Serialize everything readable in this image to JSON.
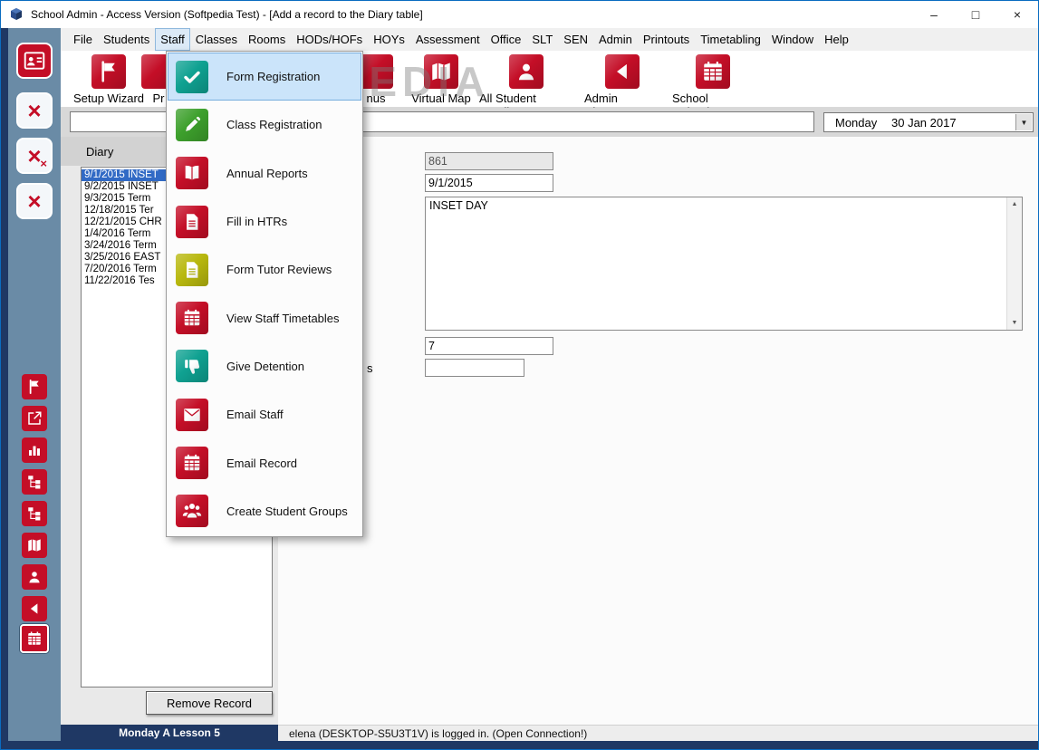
{
  "window": {
    "title": "School Admin - Access Version (Softpedia Test) - [Add a record to the Diary table]",
    "minimize_glyph": "–",
    "maximize_glyph": "□",
    "close_glyph": "×"
  },
  "colors": {
    "accent_red": "#c40e27",
    "tile_teal": "#0fa191",
    "tile_green": "#3da02c",
    "tile_yellow": "#b8b80e",
    "sidebar_blue": "#6a8ba6",
    "frame_navy": "#1f3864",
    "selection_blue": "#316ac5",
    "menu_highlight_fill": "#cbe4fa",
    "menu_highlight_border": "#77aede"
  },
  "menubar": {
    "items": [
      "File",
      "Students",
      "Staff",
      "Classes",
      "Rooms",
      "HODs/HOFs",
      "HOYs",
      "Assessment",
      "Office",
      "SLT",
      "SEN",
      "Admin",
      "Printouts",
      "Timetabling",
      "Window",
      "Help"
    ],
    "open_item": "Staff"
  },
  "staff_menu": {
    "items": [
      {
        "label": "Form Registration",
        "icon": "checkmark-icon",
        "tile_color": "#0fa191",
        "highlighted": true
      },
      {
        "label": "Class Registration",
        "icon": "pencil-icon",
        "tile_color": "#3da02c",
        "highlighted": false
      },
      {
        "label": "Annual Reports",
        "icon": "open-book-icon",
        "tile_color": "#c40e27",
        "highlighted": false
      },
      {
        "label": "Fill in HTRs",
        "icon": "document-icon",
        "tile_color": "#c40e27",
        "highlighted": false
      },
      {
        "label": "Form Tutor Reviews",
        "icon": "document-icon",
        "tile_color": "#b8b80e",
        "highlighted": false
      },
      {
        "label": "View Staff Timetables",
        "icon": "calendar-icon",
        "tile_color": "#c40e27",
        "highlighted": false
      },
      {
        "label": "Give Detention",
        "icon": "thumbs-down-icon",
        "tile_color": "#0fa191",
        "highlighted": false
      },
      {
        "label": "Email Staff",
        "icon": "envelope-icon",
        "tile_color": "#c40e27",
        "highlighted": false
      },
      {
        "label": "Email Record",
        "icon": "calendar-icon",
        "tile_color": "#c40e27",
        "highlighted": false
      },
      {
        "label": "Create Student Groups",
        "icon": "people-group-icon",
        "tile_color": "#c40e27",
        "highlighted": false
      }
    ]
  },
  "toolbar": {
    "watermark": "SOFTPEDIA",
    "items": [
      {
        "label": "Setup Wizard",
        "icon": "flag-icon"
      },
      {
        "label": "Pr",
        "icon": "partially-hidden-icon"
      },
      {
        "label": "nus",
        "icon": "partially-hidden-icon"
      },
      {
        "label": "Virtual Map",
        "icon": "map-icon"
      },
      {
        "label": "All Student Details",
        "icon": "person-icon"
      },
      {
        "label": "Admin Classes",
        "icon": "back-arrow-icon"
      },
      {
        "label": "School Calendar",
        "icon": "calendar-icon"
      }
    ]
  },
  "record_bar": {
    "search_value": "",
    "day": "Monday",
    "date": "30 Jan 2017"
  },
  "sidebar": {
    "top_buttons": [
      {
        "icon": "contact-card-icon"
      },
      {
        "icon": "close-x-icon"
      },
      {
        "icon": "close-x-double-icon"
      },
      {
        "icon": "close-x-icon"
      }
    ],
    "bottom_buttons": [
      {
        "icon": "flag-icon"
      },
      {
        "icon": "export-icon"
      },
      {
        "icon": "bar-chart-icon"
      },
      {
        "icon": "org-tree-icon"
      },
      {
        "icon": "org-tree-icon"
      },
      {
        "icon": "map-icon"
      },
      {
        "icon": "person-icon"
      },
      {
        "icon": "back-arrow-icon"
      },
      {
        "icon": "calendar-icon",
        "active": true
      }
    ]
  },
  "diary": {
    "panel_title": "Diary",
    "entries": [
      "9/1/2015 INSET",
      "9/2/2015 INSET",
      "9/3/2015 Term",
      "12/18/2015 Ter",
      "12/21/2015 CHR",
      "1/4/2016 Term",
      "3/24/2016 Term",
      "3/25/2016 EAST",
      "7/20/2016 Term",
      "11/22/2016 Tes"
    ],
    "selected_index": 0,
    "remove_button_label": "Remove Record"
  },
  "record_form": {
    "record_id": "861",
    "record_date": "9/1/2015",
    "details": "INSET DAY",
    "periods_value": "7",
    "extra_value": "",
    "visible_label_fragment": "s"
  },
  "statusbar": {
    "left": "Monday A Lesson 5",
    "message": "elena (DESKTOP-S5U3T1V) is logged in. (Open Connection!)"
  }
}
